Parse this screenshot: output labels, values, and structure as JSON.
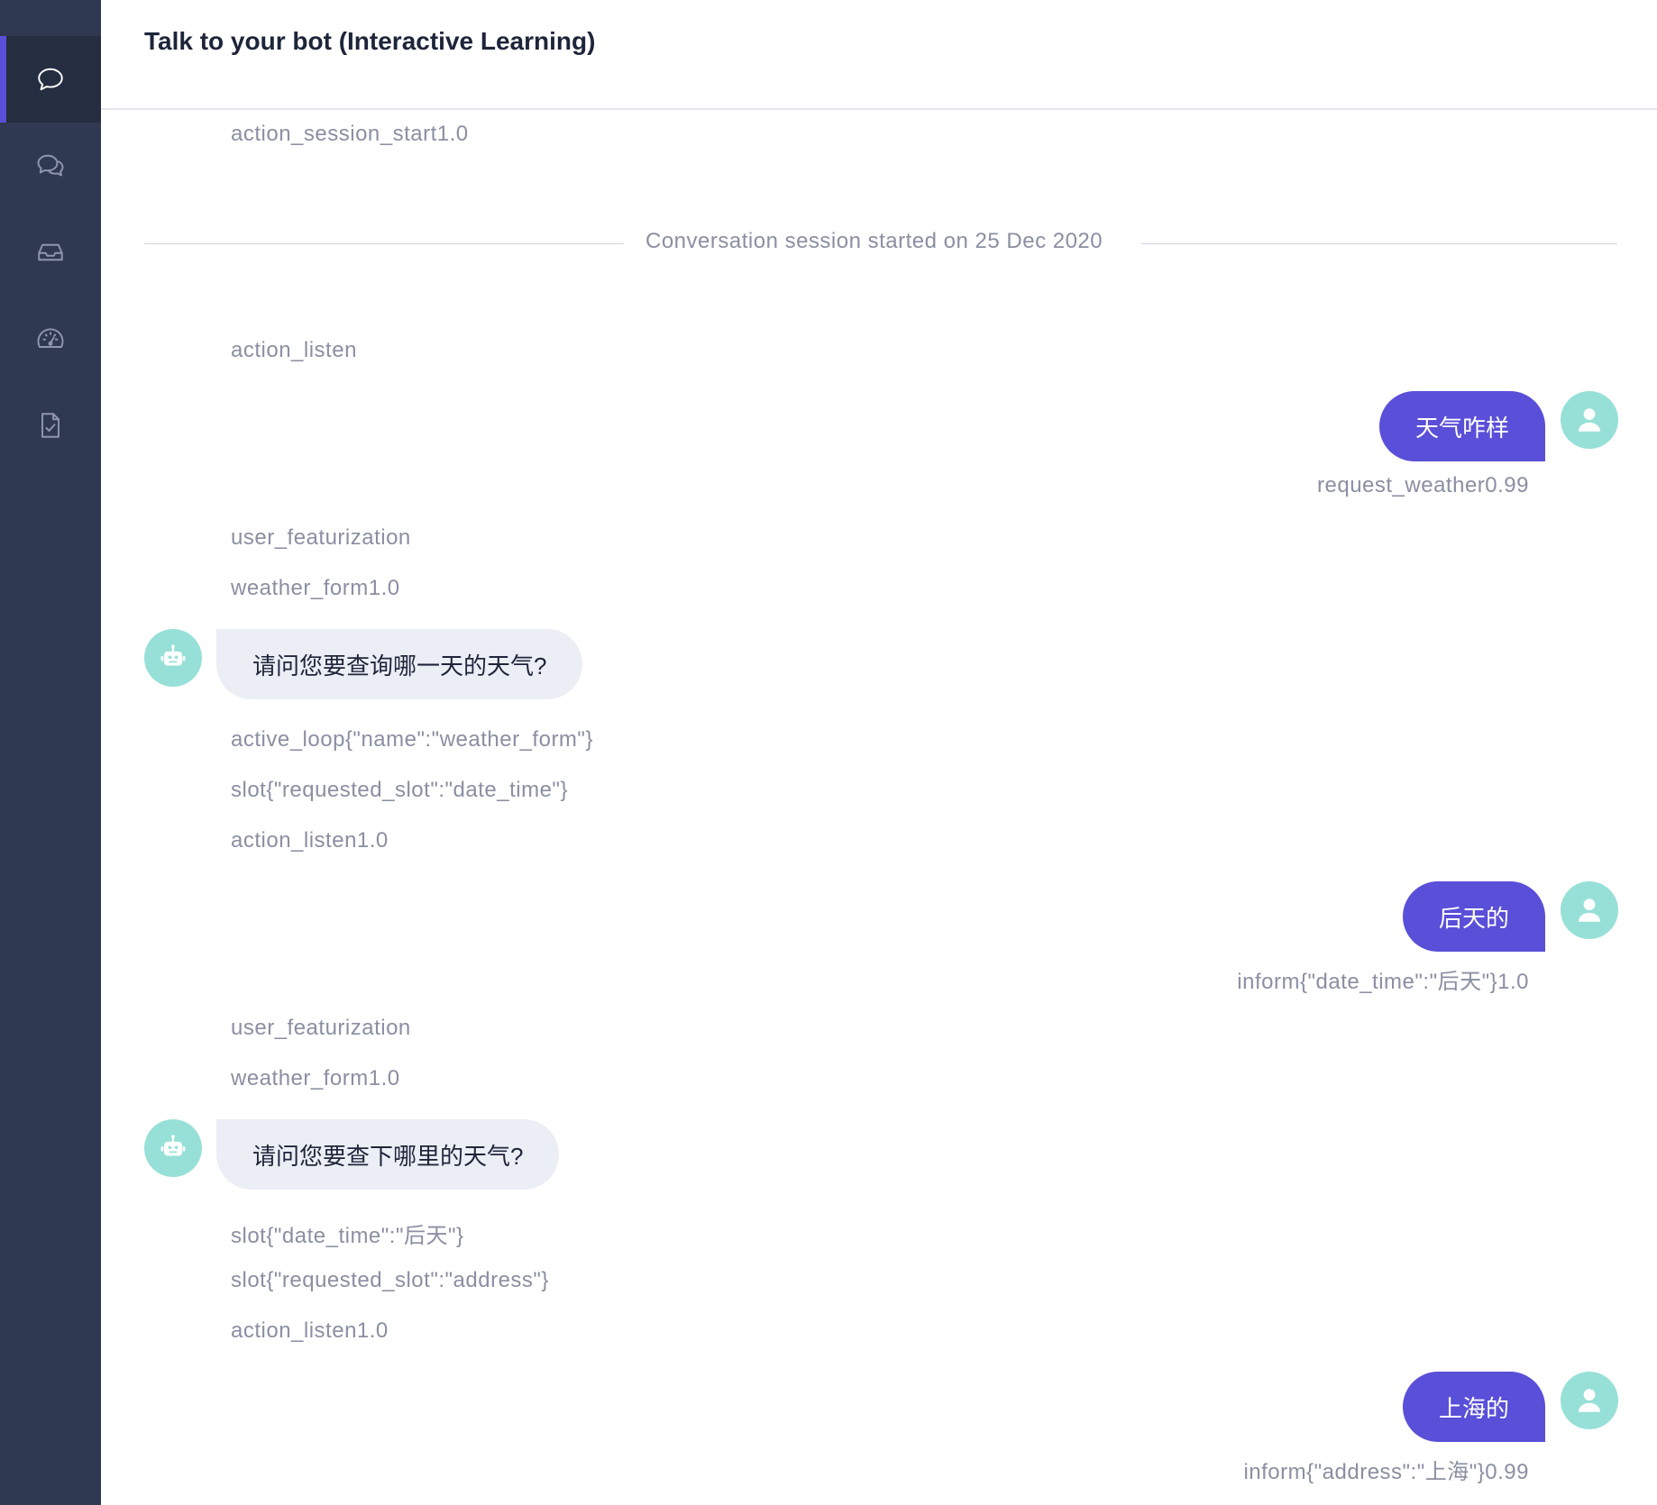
{
  "header": {
    "title": "Talk to your bot (Interactive Learning)"
  },
  "sidebar": {
    "items": [
      {
        "name": "chat",
        "icon": "chat-bubble-icon",
        "active": true
      },
      {
        "name": "conversations",
        "icon": "conversations-icon",
        "active": false
      },
      {
        "name": "inbox",
        "icon": "inbox-icon",
        "active": false
      },
      {
        "name": "dashboard",
        "icon": "gauge-icon",
        "active": false
      },
      {
        "name": "tests",
        "icon": "document-check-icon",
        "active": false
      }
    ]
  },
  "conversation": {
    "session_start_event": "action_session_start1.0",
    "divider": "Conversation session started on 25 Dec 2020",
    "events": {
      "e1": "action_listen",
      "e2": "request_weather0.99",
      "e3": "user_featurization",
      "e4": "weather_form1.0",
      "e5": "active_loop{\"name\":\"weather_form\"}",
      "e6": "slot{\"requested_slot\":\"date_time\"}",
      "e7": "action_listen1.0",
      "e8": "inform{\"date_time\":\"后天\"}1.0",
      "e9": "user_featurization",
      "e10": "weather_form1.0",
      "e11": "slot{\"date_time\":\"后天\"}",
      "e12": "slot{\"requested_slot\":\"address\"}",
      "e13": "action_listen1.0",
      "e14": "inform{\"address\":\"上海\"}0.99"
    },
    "messages": {
      "user1": "天气咋样",
      "bot1": "请问您要查询哪一天的天气?",
      "user2": "后天的",
      "bot2": "请问您要查下哪里的天气?",
      "user3": "上海的"
    }
  },
  "colors": {
    "sidebar": "#303952",
    "accent": "#5a4fd8",
    "avatar": "#97e0d8",
    "bot_bubble": "#eceef6",
    "event_text": "#8a8fa2"
  }
}
